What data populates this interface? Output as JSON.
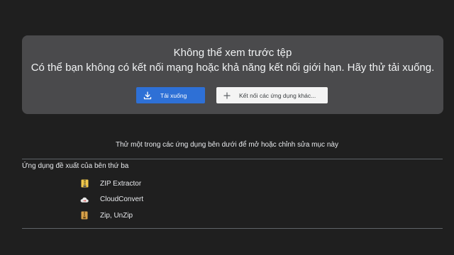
{
  "preview_card": {
    "title": "Không thể xem trước tệp",
    "subtitle": "Có thể bạn không có kết nối mạng hoặc khả năng kết nối giới hạn. Hãy thử tải xuống.",
    "download_label": "Tải xuống",
    "connect_label": "Kết nối các ứng dụng khác...",
    "download_icon": "download-icon",
    "connect_icon": "plus-icon",
    "accent_color": "#2e70d6"
  },
  "hint": "Thử một trong các ứng dụng bên dưới để mở hoặc chỉnh sửa mục này",
  "suggested": {
    "title": "Ứng dụng đề xuất của bên thứ ba",
    "apps": [
      {
        "label": "ZIP Extractor",
        "icon": "zip-extractor-icon"
      },
      {
        "label": "CloudConvert",
        "icon": "cloudconvert-icon"
      },
      {
        "label": "Zip, UnZip",
        "icon": "zip-unzip-icon"
      }
    ]
  }
}
